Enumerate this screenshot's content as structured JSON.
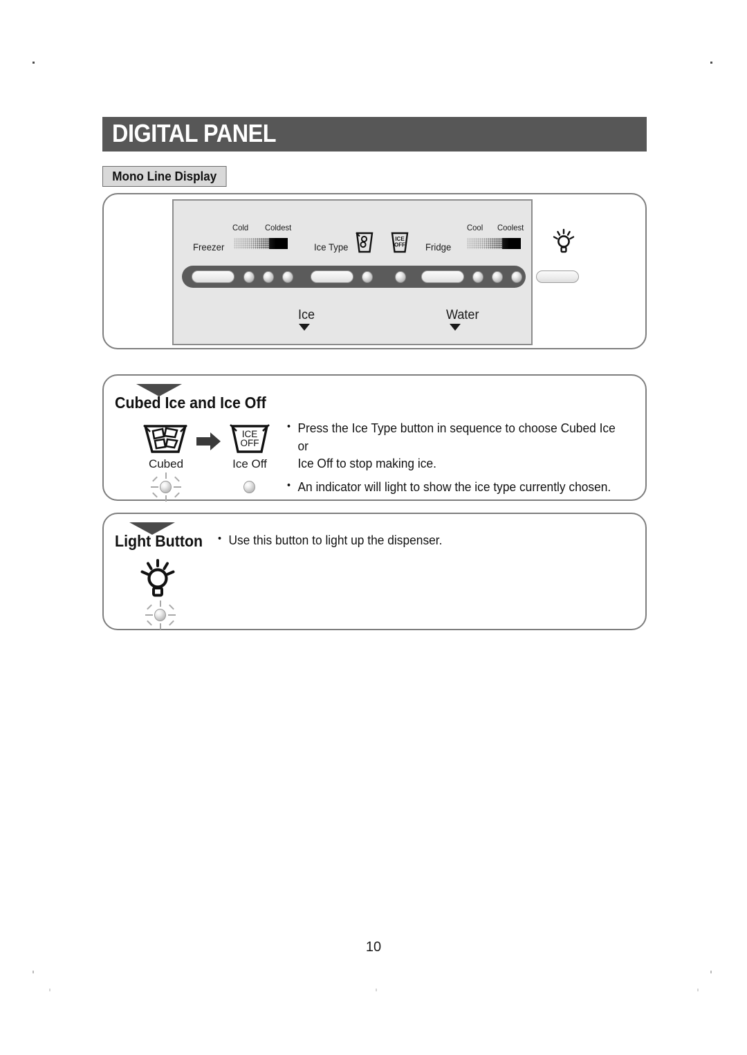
{
  "page": {
    "title": "DIGITAL PANEL",
    "subsection": "Mono Line Display",
    "page_number": "10",
    "accent_dark": "#575757",
    "panel_face": "#e6e6e6",
    "button_strip": "#5b5b5b"
  },
  "display_panel": {
    "labels": {
      "freezer": "Freezer",
      "cold": "Cold",
      "coldest": "Coldest",
      "ice_type": "Ice Type",
      "fridge": "Fridge",
      "cool": "Cool",
      "coolest": "Coolest"
    },
    "icons": {
      "cubed_ice": "cubed-ice-glass-icon",
      "ice_off": "ice-off-glass-icon",
      "light": "light-bulb-icon"
    },
    "ice_off_icon_text": {
      "line1": "ICE",
      "line2": "OFF"
    },
    "dispenser": {
      "ice": "Ice",
      "water": "Water"
    },
    "buttons": [
      {
        "name": "freezer-button"
      },
      {
        "name": "ice-type-button"
      },
      {
        "name": "fridge-button"
      },
      {
        "name": "light-button"
      }
    ],
    "indicator_counts": {
      "freezer": 3,
      "ice_type": 2,
      "fridge": 3
    }
  },
  "sections": [
    {
      "heading": "Cubed Ice and Ice Off",
      "bullets": [
        "Press the Ice Type button in sequence to choose Cubed Ice or\nIce Off to stop making ice.",
        "An indicator will light to show the ice type currently chosen."
      ],
      "icons": [
        {
          "caption": "Cubed",
          "indicator": "lit"
        },
        {
          "caption": "Ice Off",
          "indicator": "unlit"
        }
      ]
    },
    {
      "heading": "Light Button",
      "bullets": [
        "Use this button to light up the dispenser."
      ],
      "icons": [
        {
          "caption": "",
          "indicator": "lit"
        }
      ]
    }
  ]
}
